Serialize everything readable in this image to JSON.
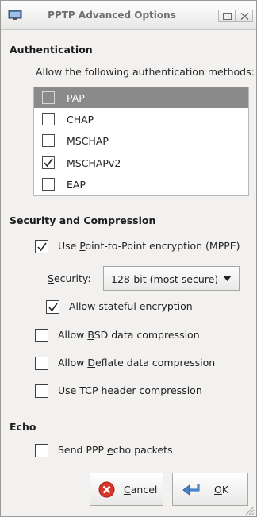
{
  "window": {
    "title": "PPTP Advanced Options"
  },
  "authentication": {
    "heading": "Authentication",
    "prompt": "Allow the following authentication methods:",
    "methods": [
      {
        "label": "PAP",
        "checked": false,
        "selected": true
      },
      {
        "label": "CHAP",
        "checked": false,
        "selected": false
      },
      {
        "label": "MSCHAP",
        "checked": false,
        "selected": false
      },
      {
        "label": "MSCHAPv2",
        "checked": true,
        "selected": false
      },
      {
        "label": "EAP",
        "checked": false,
        "selected": false
      }
    ]
  },
  "security": {
    "heading": "Security and Compression",
    "mppe": {
      "pre": "Use ",
      "mn": "P",
      "post": "oint-to-Point encryption (MPPE)",
      "checked": true
    },
    "security_label": {
      "pre": "",
      "mn": "S",
      "post": "ecurity:"
    },
    "security_value": "128-bit (most secure)",
    "stateful": {
      "pre": "Allow st",
      "mn": "a",
      "post": "teful encryption",
      "checked": true
    },
    "bsd": {
      "pre": "Allow ",
      "mn": "B",
      "post": "SD data compression",
      "checked": false
    },
    "deflate": {
      "pre": "Allow ",
      "mn": "D",
      "post": "eflate data compression",
      "checked": false
    },
    "tcp": {
      "pre": "Use TCP ",
      "mn": "h",
      "post": "eader compression",
      "checked": false
    }
  },
  "echo": {
    "heading": "Echo",
    "send": {
      "pre": "Send PPP ",
      "mn": "e",
      "post": "cho packets",
      "checked": false
    }
  },
  "buttons": {
    "cancel": {
      "mn": "C",
      "post": "ancel"
    },
    "ok": {
      "mn": "O",
      "post": "K"
    }
  },
  "colors": {
    "selected_row": "#8a8a8a",
    "window_bg": "#f2f1f0",
    "cancel_red": "#d9352b",
    "ok_blue": "#4a82c9"
  },
  "icons": [
    "network-icon",
    "maximize-icon",
    "close-icon",
    "checkmark-icon",
    "dropdown-arrow-icon",
    "cancel-icon",
    "ok-icon",
    "resize-grip-icon"
  ]
}
